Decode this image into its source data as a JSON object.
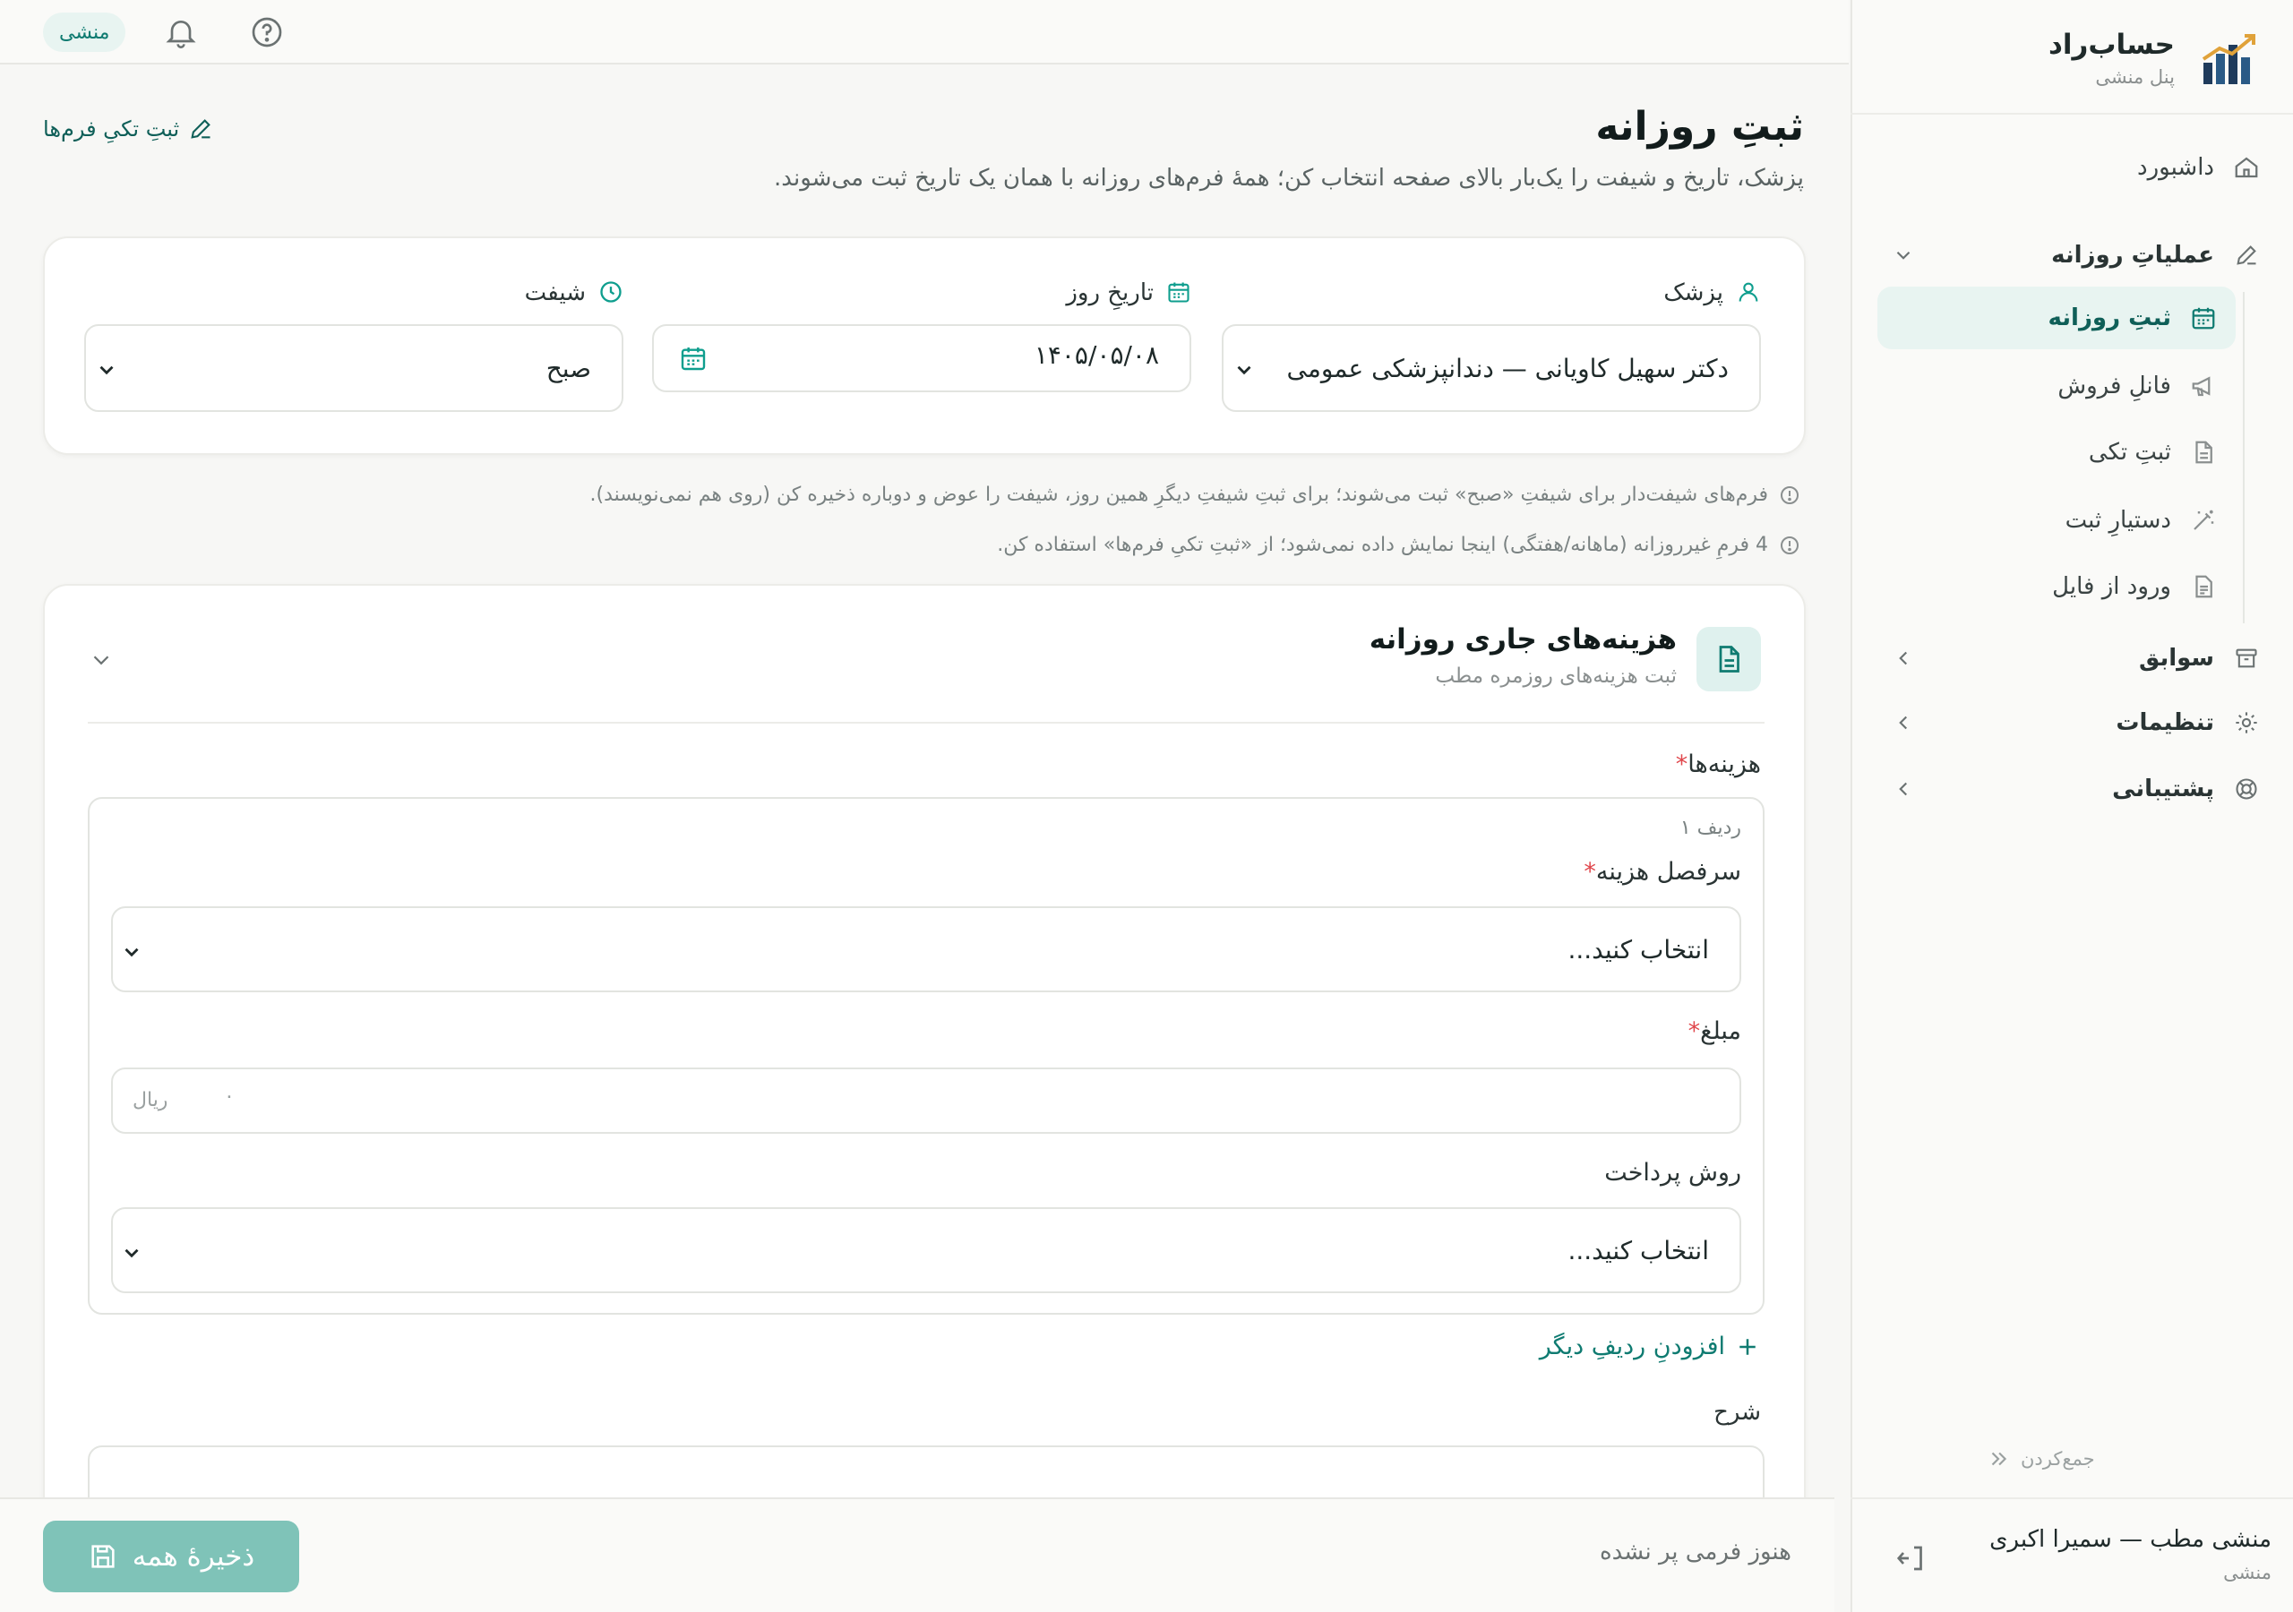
{
  "brand": {
    "name": "حساب‌راد",
    "subtitle": "پنل منشی"
  },
  "colors": {
    "accent": "#0f7b71",
    "accent_light": "#e8f4f1",
    "danger": "#e0474c",
    "save_button": "#7fc3b8"
  },
  "sidebar": {
    "dashboard": {
      "label": "داشبورد",
      "icon": "home-icon"
    },
    "daily_ops": {
      "label": "عملیاتِ روزانه",
      "icon": "pencil-icon"
    },
    "sub_items": [
      {
        "label": "ثبتِ روزانه",
        "icon": "calendar-icon",
        "active": true
      },
      {
        "label": "فانلِ فروش",
        "icon": "megaphone-icon"
      },
      {
        "label": "ثبتِ تکی",
        "icon": "document-icon"
      },
      {
        "label": "دستیارِ ثبت",
        "icon": "magic-wand-icon"
      },
      {
        "label": "ورود از فایل",
        "icon": "file-icon"
      }
    ],
    "history": {
      "label": "سوابق",
      "icon": "archive-icon"
    },
    "settings": {
      "label": "تنظیمات",
      "icon": "gear-icon"
    },
    "support": {
      "label": "پشتیبانی",
      "icon": "lifebuoy-icon"
    },
    "collapse_label": "جمع‌کردن",
    "user": {
      "name": "منشی مطب — سمیرا اکبری",
      "role": "منشی"
    }
  },
  "topbar": {
    "role_badge": "منشی"
  },
  "page": {
    "title": "ثبتِ روزانه",
    "description": "پزشک، تاریخ و شیفت را یک‌بار بالای صفحه انتخاب کن؛ همهٔ فرم‌های روزانه با همان یک تاریخ ثبت می‌شوند.",
    "single_link": "ثبتِ تکیِ فرم‌ها"
  },
  "filters": {
    "doctor": {
      "label": "پزشک",
      "value": "دکتر سهیل کاویانی — دندانپزشکی عمومی"
    },
    "date": {
      "label": "تاریخِ روز",
      "value": "۱۴۰۵/۰۵/۰۸"
    },
    "shift": {
      "label": "شیفت",
      "value": "صبح"
    }
  },
  "hints": [
    "فرم‌های شیفت‌دار برای شیفتِ «صبح» ثبت می‌شوند؛ برای ثبتِ شیفتِ دیگرِ همین روز، شیفت را عوض و دوباره ذخیره کن (روی هم نمی‌نویسند).",
    "4 فرمِ غیرروزانه (ماهانه/هفتگی) اینجا نمایش داده نمی‌شود؛ از «ثبتِ تکیِ فرم‌ها» استفاده کن."
  ],
  "form": {
    "title": "هزینه‌های جاری روزانه",
    "subtitle": "ثبت هزینه‌های روزمره مطب",
    "section_label": "هزینه‌ها",
    "row_title": "ردیف ۱",
    "expense_head": {
      "label": "سرفصل هزینه",
      "value": "انتخاب کنید..."
    },
    "amount": {
      "label": "مبلغ",
      "placeholder": "۰",
      "unit": "ریال"
    },
    "payment": {
      "label": "روش پرداخت",
      "value": "انتخاب کنید..."
    },
    "add_row": "افزودنِ ردیفِ دیگر",
    "description_label": "شرح"
  },
  "footer": {
    "save_all": "ذخیرهٔ همه",
    "status": "هنوز فرمی پر نشده"
  }
}
